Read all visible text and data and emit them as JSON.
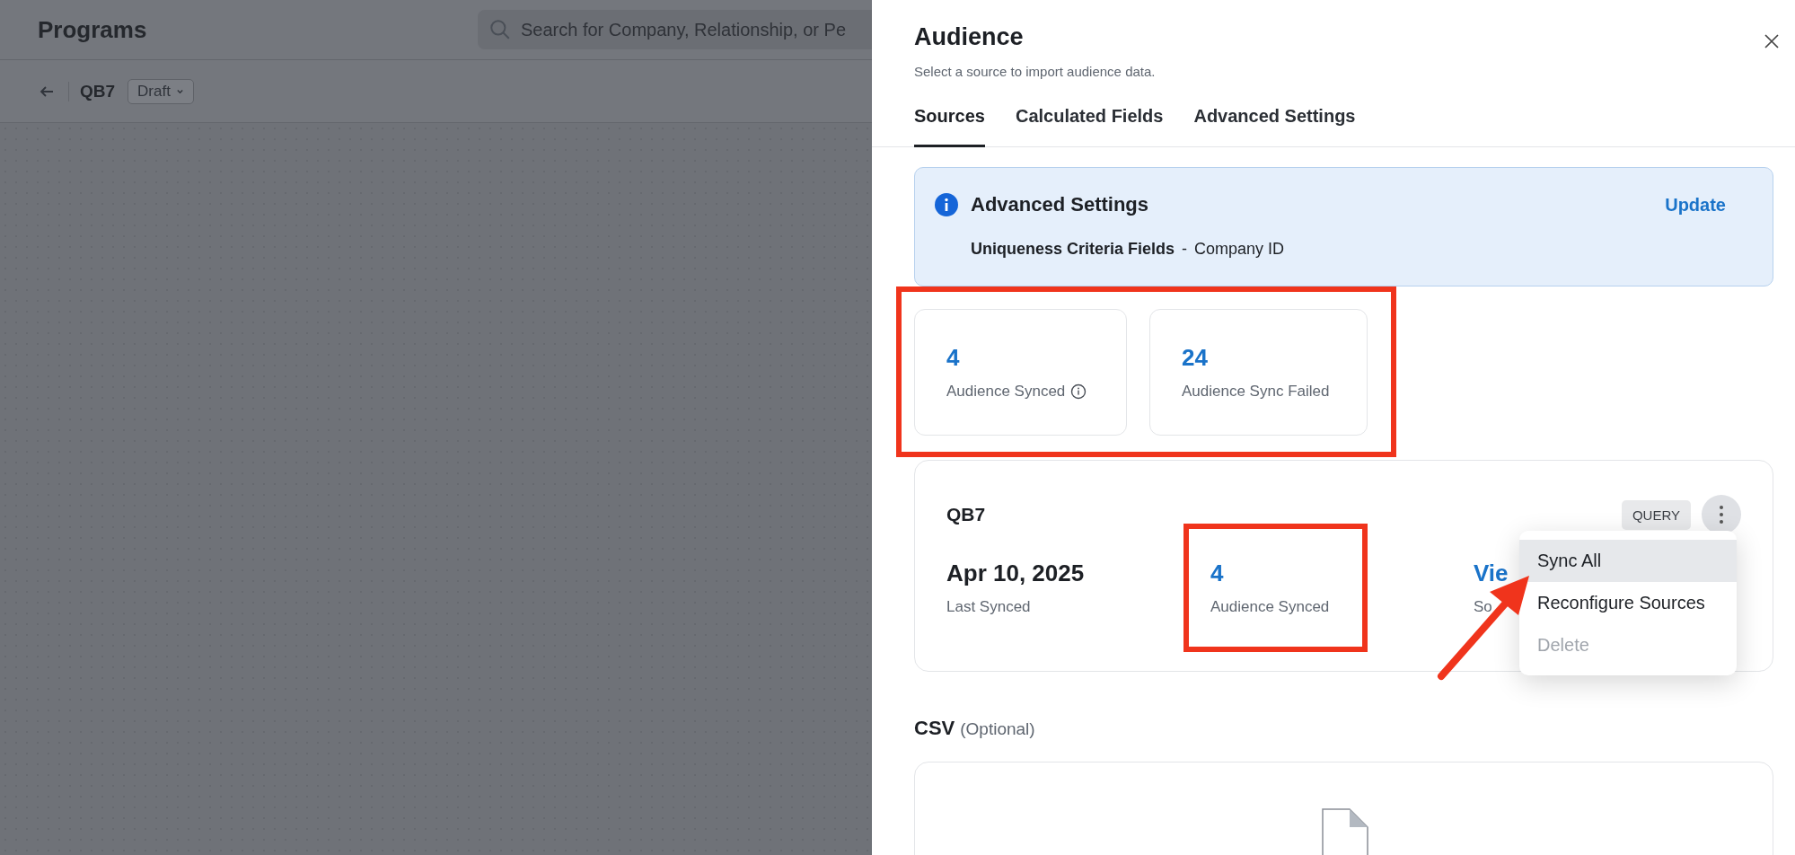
{
  "background": {
    "header": {
      "title": "Programs",
      "search": {
        "placeholder": "Search for Company, Relationship, or Pe"
      }
    },
    "subheader": {
      "title": "QB7",
      "status": "Draft"
    }
  },
  "panel": {
    "title": "Audience",
    "subtitle": "Select a source to import audience data.",
    "tabs": [
      {
        "label": "Sources",
        "selected": true
      },
      {
        "label": "Calculated Fields",
        "selected": false
      },
      {
        "label": "Advanced Settings",
        "selected": false
      }
    ],
    "notice": {
      "title": "Advanced Settings",
      "action": "Update",
      "field_label": "Uniqueness Criteria Fields",
      "separator": "-",
      "field_value": "Company ID"
    },
    "stats_highlighted": true,
    "stats": [
      {
        "value": "4",
        "label": "Audience Synced",
        "info": true
      },
      {
        "value": "24",
        "label": "Audience Sync Failed",
        "info": false
      }
    ],
    "source": {
      "name": "QB7",
      "type": "QUERY",
      "metrics": [
        {
          "kind": "date",
          "value": "Apr 10, 2025",
          "label": "Last Synced"
        },
        {
          "kind": "count",
          "value": "4",
          "label": "Audience Synced",
          "highlighted": true
        },
        {
          "kind": "link",
          "value": "Vie",
          "label": "So"
        }
      ],
      "menu": [
        {
          "label": "Sync All",
          "selected": true,
          "disabled": false,
          "pointed_at": true
        },
        {
          "label": "Reconfigure Sources",
          "selected": false,
          "disabled": false
        },
        {
          "label": "Delete",
          "selected": false,
          "disabled": true
        }
      ]
    },
    "csv": {
      "title": "CSV",
      "note": "(Optional)"
    }
  }
}
